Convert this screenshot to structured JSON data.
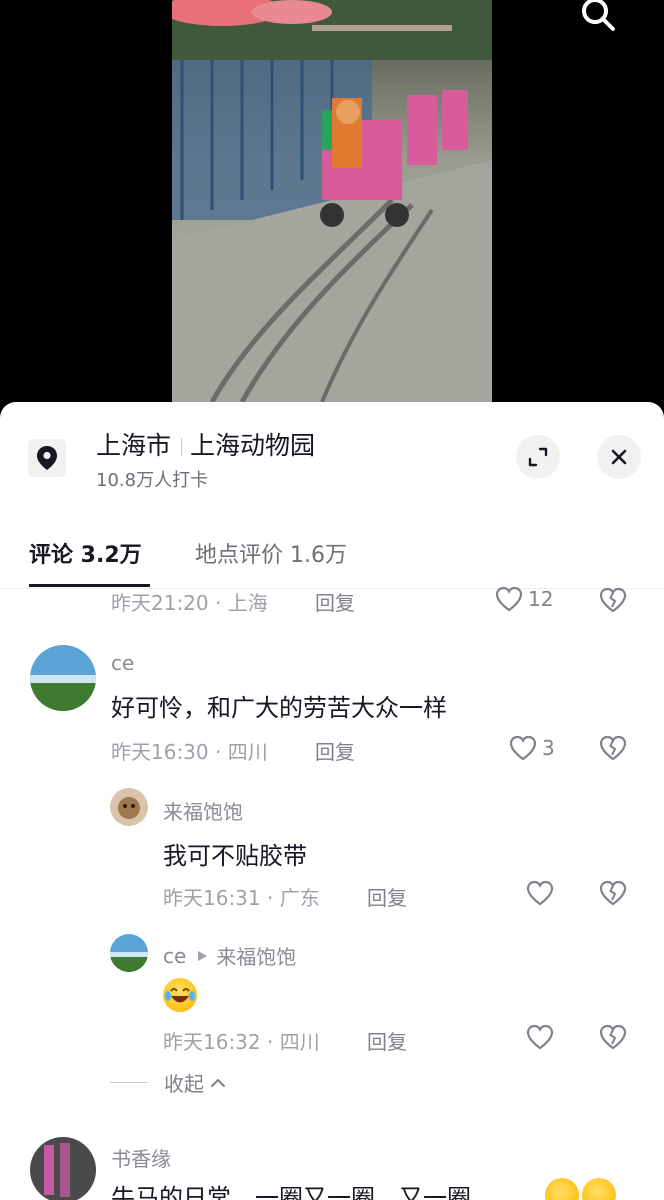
{
  "header": {
    "search_icon": "search-icon"
  },
  "location": {
    "city": "上海市",
    "place": "上海动物园",
    "checkins": "10.8万人打卡",
    "icon": "location-pin-icon",
    "expand_icon": "expand-icon",
    "close_icon": "close-icon"
  },
  "tabs": [
    {
      "label": "评论 3.2万",
      "active": true
    },
    {
      "label": "地点评价 1.6万",
      "active": false
    }
  ],
  "comments": [
    {
      "meta": "昨天21:20 · 上海",
      "reply": "回复",
      "likes": "12"
    },
    {
      "user": "ce",
      "text": "好可怜，和广大的劳苦大众一样",
      "meta": "昨天16:30 · 四川",
      "reply": "回复",
      "likes": "3"
    },
    {
      "user": "来福饱饱",
      "text": "我可不贴胶带",
      "meta": "昨天16:31 · 广东",
      "reply": "回复",
      "likes": ""
    },
    {
      "user": "ce",
      "reply_to": "来福饱饱",
      "text": "",
      "emoji": "laughing-crying-emoji",
      "meta": "昨天16:32 · 四川",
      "reply": "回复",
      "likes": ""
    },
    {
      "user": "书香缘",
      "text": "牛马的日常，一圈又一圈，又一圈",
      "emoji": "sweat-smile-emoji"
    }
  ],
  "collapse_label": "收起",
  "colors": {
    "text": "#161823",
    "secondary": "#80818a",
    "meta": "#a0a1a8",
    "sheet": "#ffffff"
  }
}
